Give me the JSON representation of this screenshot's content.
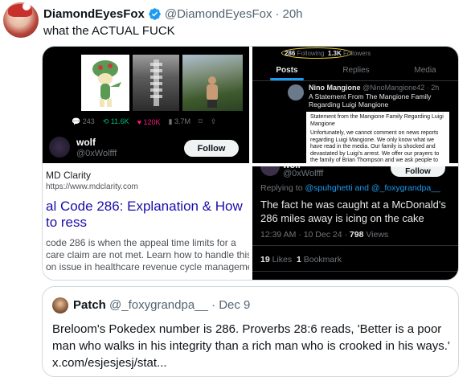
{
  "tweet": {
    "author_name": "DiamondEyesFox",
    "author_handle": "@DiamondEyesFox",
    "time": "20h",
    "text": "what the ACTUAL FUCK",
    "colors": {
      "verified": "#1d9bf0",
      "text": "#0f1419",
      "muted": "#536471"
    }
  },
  "media": {
    "top_left": {
      "stats": {
        "replies": "243",
        "reposts": "11.6K",
        "likes": "120K",
        "views": "3.7M"
      },
      "profile_name": "wolf",
      "profile_handle": "@0xWolfff",
      "follow_label": "Follow"
    },
    "top_right": {
      "following_count": "286",
      "following_label": "Following",
      "followers_count": "1.3K",
      "followers_label": "Followers",
      "tabs": [
        "Posts",
        "Replies",
        "Media"
      ],
      "post_author": "Nino Mangione",
      "post_handle": "@NinoMangione42 · 2h",
      "post_text": "A Statement From The Mangione Family Regarding Luigi Mangione",
      "statement_title": "Statement from the Mangione Family Regarding Luigi Mangione",
      "statement_body_1": "Unfortunately, we cannot comment on news reports regarding Luigi Mangione. We only know what we have read in the media. Our family is shocked and devastated by Luigi's arrest. We offer our prayers to the family of Brian Thompson and we ask people to pray for all involved."
    },
    "bottom_left": {
      "site_name": "MD Clarity",
      "site_url": "https://www.mdclarity.com",
      "title": "al Code 286: Explanation & How to ress",
      "description_lines": [
        "code 286 is when the appeal time limits for a",
        "care claim are not met. Learn how to handle this",
        "on issue in healthcare revenue cycle managemer"
      ]
    },
    "bottom_right": {
      "author_name": "wolf",
      "author_handle": "@0xWolfff",
      "follow_label": "Follow",
      "replying_prefix": "Replying to",
      "replying_to": "@spuhghetti and @_foxygrandpa__",
      "text": "The fact he was caught at a McDonald's 286 miles away is icing on the cake",
      "meta_time": "12:39 AM · 10 Dec 24 ·",
      "views_count": "798",
      "views_label": "Views",
      "likes_count": "19",
      "likes_label": "Likes",
      "bookmarks_count": "1",
      "bookmarks_label": "Bookmark"
    }
  },
  "quote": {
    "author_name": "Patch",
    "author_handle": "@_foxygrandpa__",
    "time": "Dec 9",
    "text": "Breloom's Pokedex number is 286. Proverbs 28:6 reads, 'Better is a poor man who walks in his integrity than a rich man who is crooked in his ways.' x.com/esjesjesj/stat..."
  }
}
